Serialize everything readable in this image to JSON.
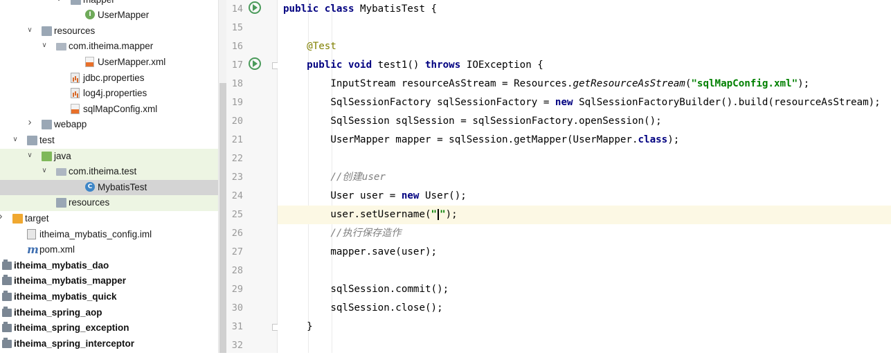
{
  "project_tree": {
    "rows": [
      {
        "label": "mapper",
        "indent": 4,
        "icon": "folder-icon",
        "arrow": "expanded"
      },
      {
        "label": "UserMapper",
        "indent": 5,
        "icon": "interface-icon",
        "arrow": ""
      },
      {
        "label": "resources",
        "indent": 2,
        "icon": "resources-folder-icon",
        "arrow": "expanded"
      },
      {
        "label": "com.itheima.mapper",
        "indent": 3,
        "icon": "package-icon",
        "arrow": "expanded"
      },
      {
        "label": "UserMapper.xml",
        "indent": 5,
        "icon": "xml-file-icon",
        "arrow": ""
      },
      {
        "label": "jdbc.properties",
        "indent": 4,
        "icon": "properties-file-icon",
        "arrow": ""
      },
      {
        "label": "log4j.properties",
        "indent": 4,
        "icon": "properties-file-icon",
        "arrow": ""
      },
      {
        "label": "sqlMapConfig.xml",
        "indent": 4,
        "icon": "xml-file-icon",
        "arrow": ""
      },
      {
        "label": "webapp",
        "indent": 2,
        "icon": "folder-icon",
        "arrow": "collapsed"
      },
      {
        "label": "test",
        "indent": 1,
        "icon": "folder-icon",
        "arrow": "expanded"
      },
      {
        "label": "java",
        "indent": 2,
        "icon": "test-source-folder-icon",
        "arrow": "expanded"
      },
      {
        "label": "com.itheima.test",
        "indent": 3,
        "icon": "package-icon",
        "arrow": "expanded"
      },
      {
        "label": "MybatisTest",
        "indent": 5,
        "icon": "class-icon",
        "arrow": ""
      },
      {
        "label": "resources",
        "indent": 3,
        "icon": "resources-folder-icon",
        "arrow": ""
      },
      {
        "label": "target",
        "indent": 0,
        "icon": "excluded-folder-icon",
        "arrow": "collapsed"
      },
      {
        "label": "itheima_mybatis_config.iml",
        "indent": 1,
        "icon": "iml-file-icon",
        "arrow": ""
      },
      {
        "label": "pom.xml",
        "indent": 1,
        "icon": "maven-icon",
        "arrow": ""
      },
      {
        "label": "itheima_mybatis_dao",
        "indent": 0,
        "icon": "module-icon",
        "arrow": "",
        "bold": true
      },
      {
        "label": "itheima_mybatis_mapper",
        "indent": 0,
        "icon": "module-icon",
        "arrow": "",
        "bold": true
      },
      {
        "label": "itheima_mybatis_quick",
        "indent": 0,
        "icon": "module-icon",
        "arrow": "",
        "bold": true
      },
      {
        "label": "itheima_spring_aop",
        "indent": 0,
        "icon": "module-icon",
        "arrow": "",
        "bold": true
      },
      {
        "label": "itheima_spring_exception",
        "indent": 0,
        "icon": "module-icon",
        "arrow": "",
        "bold": true
      },
      {
        "label": "itheima_spring_interceptor",
        "indent": 0,
        "icon": "module-icon",
        "arrow": "",
        "bold": true
      }
    ],
    "selected": "MybatisTest"
  },
  "editor": {
    "lines": [
      {
        "no": "14",
        "run": true,
        "fold": false,
        "tokens": [
          [
            "kw",
            "public class "
          ],
          [
            "",
            "MybatisTest {"
          ]
        ]
      },
      {
        "no": "15",
        "tokens": []
      },
      {
        "no": "16",
        "tokens": [
          [
            "",
            "    "
          ],
          [
            "ann",
            "@Test"
          ]
        ]
      },
      {
        "no": "17",
        "run": true,
        "fold": true,
        "tokens": [
          [
            "",
            "    "
          ],
          [
            "kw",
            "public void "
          ],
          [
            "",
            "test1() "
          ],
          [
            "kw",
            "throws "
          ],
          [
            "",
            "IOException {"
          ]
        ]
      },
      {
        "no": "18",
        "tokens": [
          [
            "",
            "        InputStream resourceAsStream = Resources."
          ],
          [
            "it",
            "getResourceAsStream"
          ],
          [
            "",
            "("
          ],
          [
            "str",
            "\"sqlMapConfig.xml\""
          ],
          [
            "",
            ");"
          ]
        ]
      },
      {
        "no": "19",
        "tokens": [
          [
            "",
            "        SqlSessionFactory sqlSessionFactory = "
          ],
          [
            "kw",
            "new "
          ],
          [
            "",
            "SqlSessionFactoryBuilder().build(resourceAsStream);"
          ]
        ]
      },
      {
        "no": "20",
        "tokens": [
          [
            "",
            "        SqlSession sqlSession = sqlSessionFactory.openSession();"
          ]
        ]
      },
      {
        "no": "21",
        "tokens": [
          [
            "",
            "        UserMapper mapper = sqlSession.getMapper(UserMapper."
          ],
          [
            "kw",
            "class"
          ],
          [
            "",
            ");"
          ]
        ]
      },
      {
        "no": "22",
        "tokens": []
      },
      {
        "no": "23",
        "tokens": [
          [
            "",
            "        "
          ],
          [
            "cm",
            "//创建user"
          ]
        ]
      },
      {
        "no": "24",
        "tokens": [
          [
            "",
            "        User user = "
          ],
          [
            "kw",
            "new "
          ],
          [
            "",
            "User();"
          ]
        ]
      },
      {
        "no": "25",
        "current": true,
        "tokens": [
          [
            "",
            "        user.setUsername("
          ],
          [
            "str",
            "\""
          ],
          [
            "caret",
            ""
          ],
          [
            "str",
            "\""
          ],
          [
            "",
            ");"
          ]
        ]
      },
      {
        "no": "26",
        "tokens": [
          [
            "",
            "        "
          ],
          [
            "cm",
            "//执行保存造作"
          ]
        ]
      },
      {
        "no": "27",
        "tokens": [
          [
            "",
            "        mapper.save(user);"
          ]
        ]
      },
      {
        "no": "28",
        "tokens": []
      },
      {
        "no": "29",
        "tokens": [
          [
            "",
            "        sqlSession.commit();"
          ]
        ]
      },
      {
        "no": "30",
        "tokens": [
          [
            "",
            "        sqlSession.close();"
          ]
        ]
      },
      {
        "no": "31",
        "fold": true,
        "tokens": [
          [
            "",
            "    }"
          ]
        ]
      },
      {
        "no": "32",
        "tokens": []
      }
    ]
  },
  "colors": {
    "keyword": "#000080",
    "annotation": "#808000",
    "string": "#008000",
    "comment": "#808080",
    "current_line": "#fcf8e4",
    "selected_row": "#d4d4d4",
    "test_highlight": "#edf5e3"
  }
}
